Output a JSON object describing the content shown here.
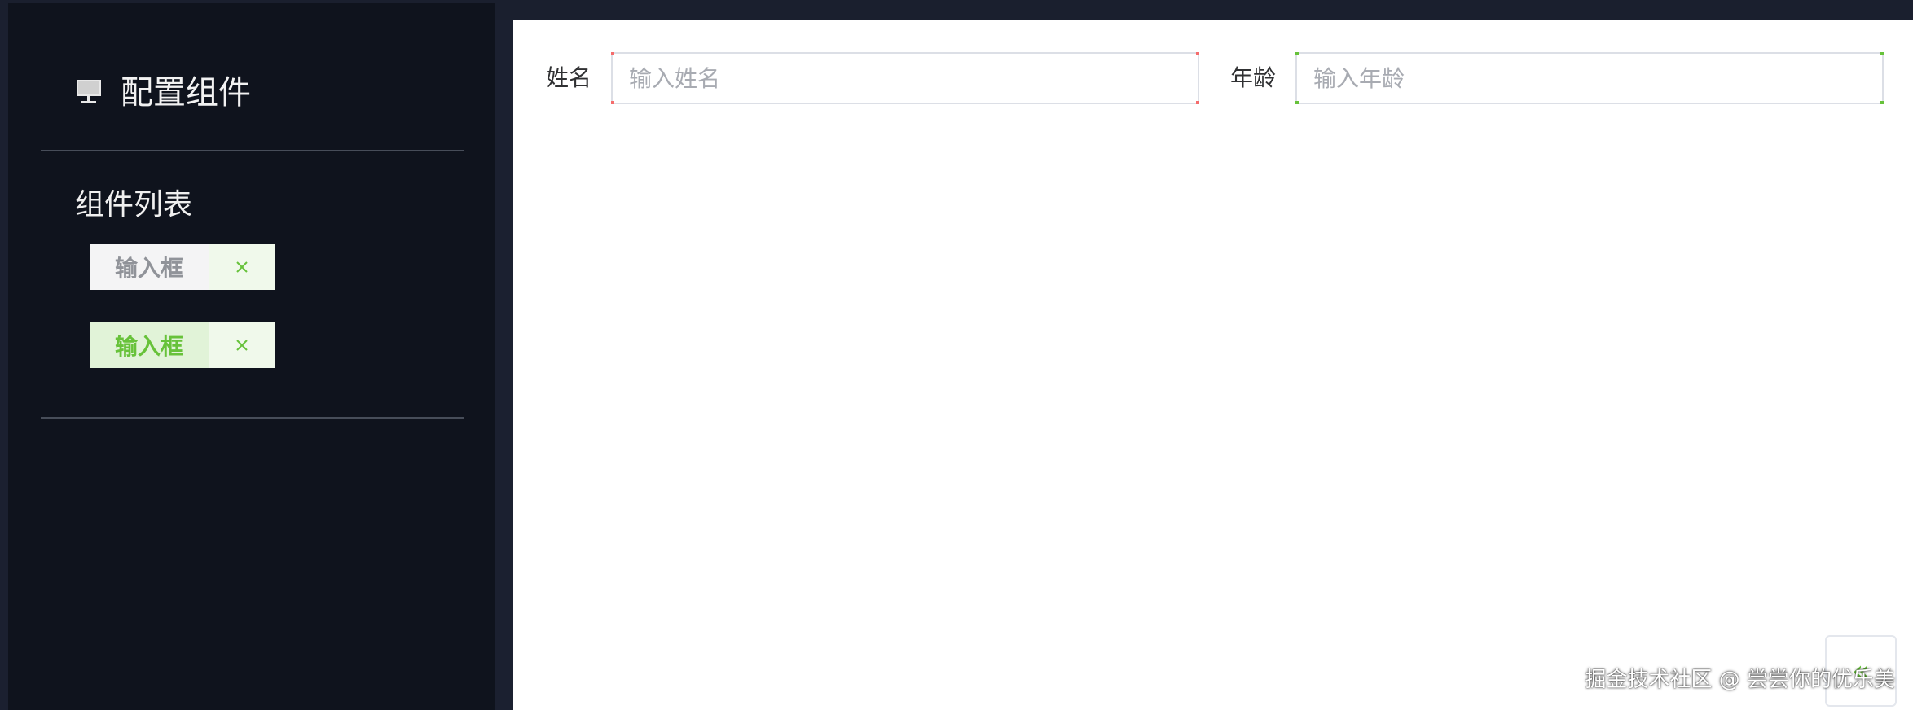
{
  "sidebar": {
    "title": "配置组件",
    "title_icon": "monitor-icon",
    "list_title": "组件列表",
    "components": [
      {
        "label": "输入框",
        "state": "default",
        "close_icon": "close-icon"
      },
      {
        "label": "输入框",
        "state": "active",
        "close_icon": "close-icon"
      }
    ]
  },
  "form": {
    "fields": [
      {
        "label": "姓名",
        "placeholder": "输入姓名",
        "value": "",
        "border_accent": "#f56c6c"
      },
      {
        "label": "年龄",
        "placeholder": "输入年龄",
        "value": "",
        "border_accent": "#67c23a"
      }
    ]
  },
  "collapse_button": {
    "icon": "double-chevron-left-icon",
    "glyph": "«"
  },
  "footer": {
    "credit": "掘金技术社区 @ 尝尝你的优乐美"
  },
  "colors": {
    "sidebar_bg": "#0f131d",
    "accent_green": "#67c23a",
    "tag_default_text": "#909399"
  }
}
